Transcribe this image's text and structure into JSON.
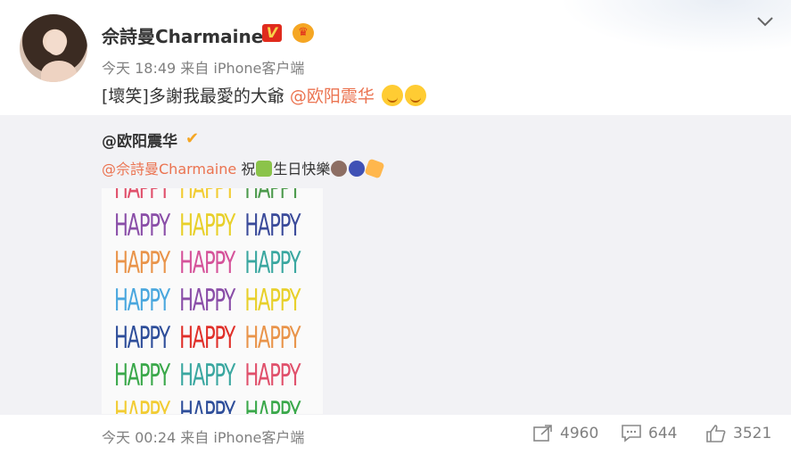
{
  "post": {
    "username": "佘詩曼Charmaine",
    "meta": "今天 18:49 来自 iPhone客户端",
    "text_prefix": "[壞笑]多謝我最愛的大爺",
    "mention": "@欧阳震华"
  },
  "repost": {
    "username": "@欧阳震华",
    "mention": "@佘詩曼Charmaine",
    "text_a": "祝",
    "text_b": "生日快樂",
    "image": {
      "word": "HAPPY",
      "rows": [
        [
          "#e0506b",
          "#f2cc33",
          "#4c9a4c"
        ],
        [
          "#8a4ea8",
          "#e8d02a",
          "#3a4a9a"
        ],
        [
          "#e9944a",
          "#d5539a",
          "#3aa7a0"
        ],
        [
          "#4aa7de",
          "#8a4ea8",
          "#e8d02a"
        ],
        [
          "#2e4e9a",
          "#e0302a",
          "#e9944a"
        ],
        [
          "#3aa84a",
          "#3aa7a0",
          "#e0506b"
        ],
        [
          "#f2cc33",
          "#2e4e9a",
          "#3aa84a"
        ]
      ]
    }
  },
  "footer": {
    "meta": "今天 00:24 来自 iPhone客户端",
    "reposts": "4960",
    "comments": "644",
    "likes": "3521"
  },
  "colors": {
    "mention": "#eb7350",
    "repost_bg": "#f2f2f5",
    "vip_badge": "#e02b1d"
  }
}
